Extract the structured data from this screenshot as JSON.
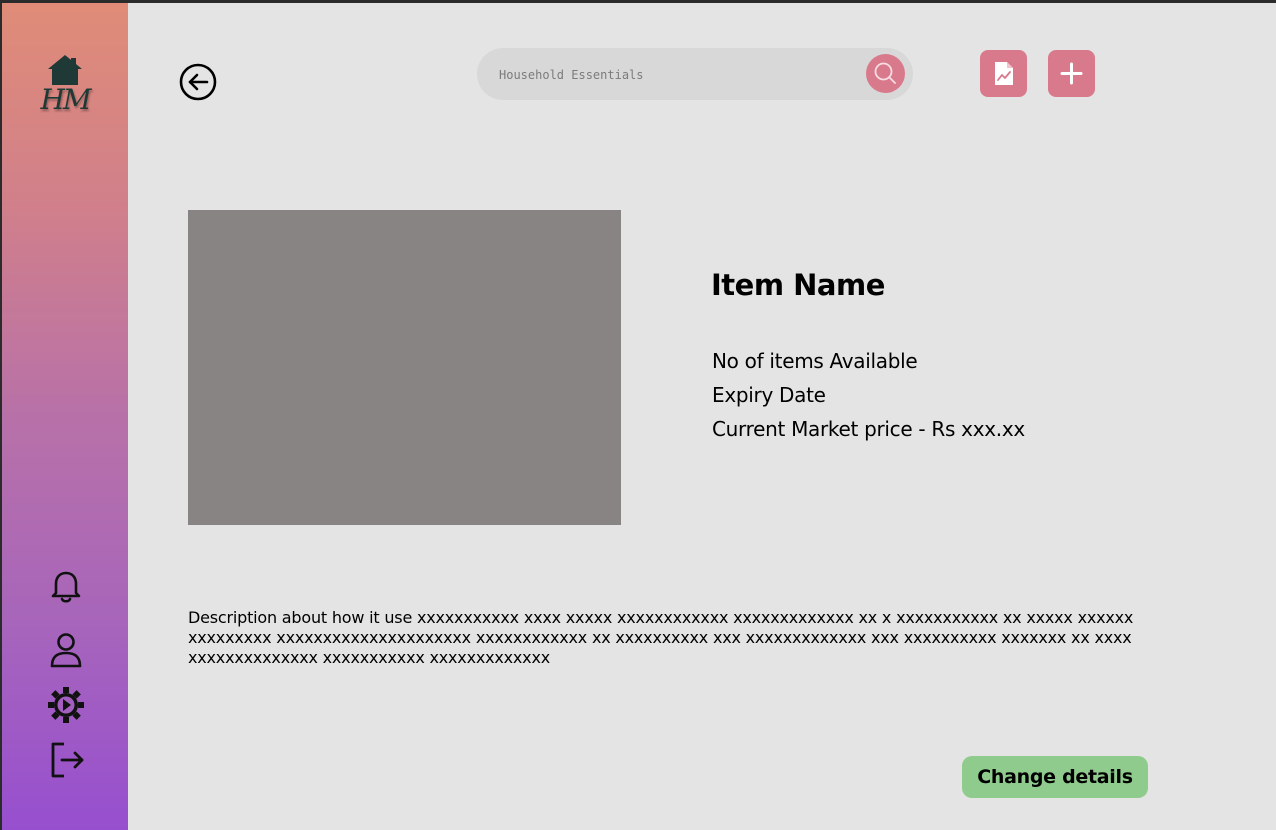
{
  "sidebar": {
    "logo_text": "HM",
    "icons": [
      "home-icon",
      "bell-icon",
      "user-icon",
      "settings-icon",
      "logout-icon"
    ]
  },
  "header": {
    "search": {
      "placeholder": "Household Essentials",
      "icon": "search-icon"
    },
    "actions": [
      {
        "name": "report",
        "icon": "document-chart-icon"
      },
      {
        "name": "add",
        "icon": "plus-icon"
      }
    ]
  },
  "item": {
    "name": "Item Name",
    "available_label": "No of items Available",
    "expiry_label": "Expiry Date",
    "price_label": "Current Market price - Rs xxx.xx",
    "description": "Description about how it use xxxxxxxxxxx xxxx xxxxx xxxxxxxxxxxx xxxxxxxxxxxxx xx x xxxxxxxxxxx xx xxxxx xxxxxx xxxxxxxxx xxxxxxxxxxxxxxxxxxxxx xxxxxxxxxxxx xx xxxxxxxxxx xxx xxxxxxxxxxxxx xxx xxxxxxxxxx xxxxxxx xx xxxx xxxxxxxxxxxxxx xxxxxxxxxxx xxxxxxxxxxxxx"
  },
  "footer": {
    "change_details_label": "Change details"
  },
  "colors": {
    "accent_pink": "#d97a8c",
    "button_green": "#8fcb8d",
    "background": "#e4e4e4",
    "image_placeholder": "#888483",
    "sidebar_top": "#e08c78",
    "sidebar_bottom": "#974fcf"
  }
}
